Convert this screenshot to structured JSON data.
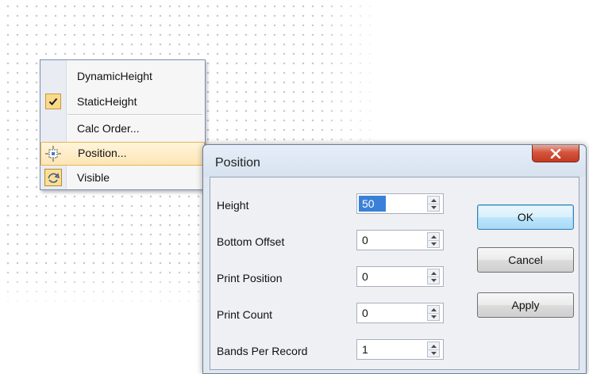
{
  "context_menu": {
    "items": [
      {
        "label": "DynamicHeight",
        "checked": false
      },
      {
        "label": "StaticHeight",
        "checked": true
      },
      {
        "label": "Calc Order..."
      },
      {
        "label": "Position...",
        "icon": "position-icon",
        "highlighted": true
      },
      {
        "label": "Visible",
        "icon": "visible-icon"
      }
    ]
  },
  "dialog": {
    "title": "Position",
    "close_symbol": "x",
    "fields": [
      {
        "label": "Height",
        "value": "50"
      },
      {
        "label": "Bottom Offset",
        "value": "0"
      },
      {
        "label": "Print Position",
        "value": "0"
      },
      {
        "label": "Print Count",
        "value": "0"
      },
      {
        "label": "Bands Per Record",
        "value": "1"
      }
    ],
    "buttons": {
      "ok": "OK",
      "cancel": "Cancel",
      "apply": "Apply"
    }
  },
  "colors": {
    "menu_highlight": "#fde6b4",
    "dialog_background": "#dfe7f1",
    "close_button": "#c33a22",
    "default_button_border": "#3c7fb1"
  }
}
